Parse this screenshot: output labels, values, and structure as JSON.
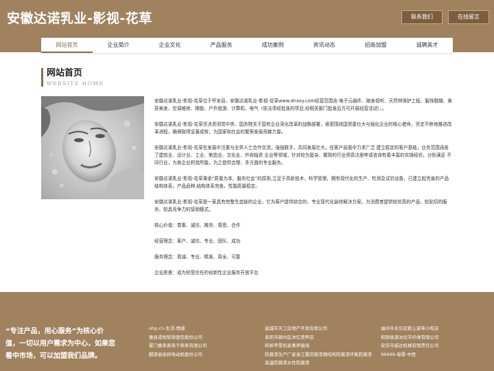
{
  "header": {
    "site_title": "安徽达诺乳业-影视-花草",
    "contact_button": "联系我们",
    "message_button": "在线留言"
  },
  "nav": {
    "items": [
      {
        "label": "网站首页",
        "active": true
      },
      {
        "label": "企业简介"
      },
      {
        "label": "企业文化"
      },
      {
        "label": "产品服务"
      },
      {
        "label": "成功案例"
      },
      {
        "label": "资讯动态"
      },
      {
        "label": "招商加盟"
      },
      {
        "label": "诚聘英才"
      }
    ]
  },
  "section": {
    "title": "网站首页",
    "subtitle": "WEBSITE HOME"
  },
  "content": {
    "paragraphs": [
      "安徽达诺乳业-影视-花草位于怀安县，安徽达诺乳业-影视-花草www.dnxoy.com经营范围含:电子元器件、随身视听、天然林保护工程、服饰鞋帽、美容美发、空调维修、橡胶、户外旅游、计算机、电气（依法须经批准的项目,经相关部门批准后方可开展经营活动）。。",
      "安徽达诺乳业-影视-花草坚决贯彻党中央、国务院关于国有企业深化改革的战略部署，紧密围绕国资委壮大与强化企业的核心使命，坚定不移地推进改革进程，确保取得显著成效，为国家和社会的繁荣发展贡献力量。",
      "安徽达诺乳业-影视-花草在发展中注重与业界人士合作交流，强强联手，共同发展壮大。在客户层面中力求广泛 建立稳定的客户基础，业务范围涵盖了建筑业、设计业、工业、制造业、文化业、外商独资 企业等领域，针对较为复杂、繁琐的行业资质注册申请咨询有着丰富的实操经验，分别满足 不同行业，为各企业积其所能，为之提供合理、多方面的专业服务。",
      "安徽达诺乳业-影视-花草秉承“质量为本，服务社会”的原则,立足于高新技术，科学管理，拥有现代化的生产、检测及试验设备，已建立起完善的产品结构体系，产品品种,结构体系完善，性能质量稳定。",
      "安徽达诺乳业-影视-花草是一家具有完整生态链的企业，它为客户提供综合的、专业现代化装修解决方案。为消费者提供较优质的产品、较贴切的服务、较具竞争力的营销模式。",
      "核心价值：尊重、诚信、推崇、感恩、合作",
      "经营理念：客户、诚信、专业、团队、成功",
      "服务理念：真诚、专业、精准、周全、可靠",
      "企业愿景：成为较受信任的创新性企业服务开放平台"
    ]
  },
  "footer": {
    "slogan": "“专注产品，用心服务”为核心价值，一切以用户需求为中心，如果您看中市场，可以加盟我们品牌。",
    "col1": [
      "ohp.cn-生活-情感",
      "雅县诺他软饼面包股份公司",
      "厦门嘉来真电子商务有限公司",
      "麒游县绘祥电动机股份公司"
    ],
    "col2": [
      "盐城市天工房地产开发有限公司",
      "阜阳市颍州区沐忆美甲店",
      "昕盼苹雪凯家禽养殖场",
      "防腐漆生产厂家浙江重防腐漆钢结构防腐漆环氧防腐漆高温防腐漆水性防腐漆"
    ],
    "col3": [
      "福州市长乐区鹤上家味小吃店",
      "和颐县渡冰化学纤维有限公司",
      "安庆市威达机械有限责任公司",
      "96999-母婴-中医"
    ]
  }
}
